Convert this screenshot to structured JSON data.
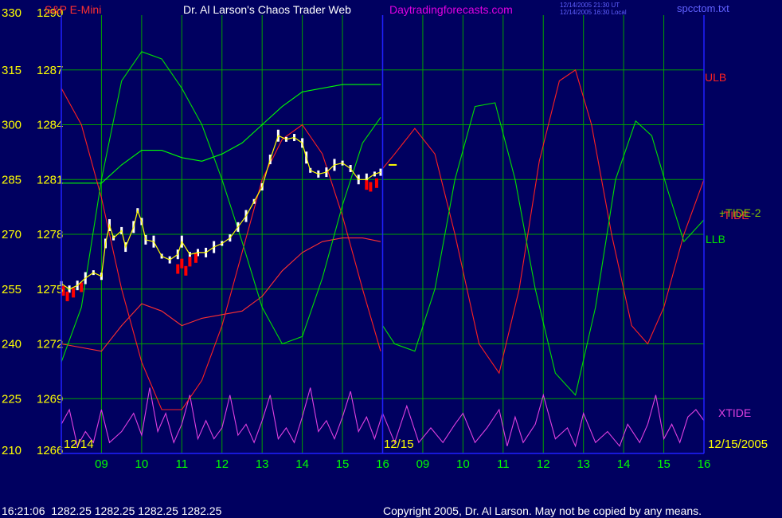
{
  "header": {
    "symbol": "S&P E-Mini",
    "site_title": "Dr. Al Larson's Chaos Trader Web",
    "site_url": "Daytradingforecasts.com",
    "stamp_line1": "12/14/2005 21:30 UT",
    "stamp_line2": "12/14/2005 16:30 Local",
    "file_name": "spcctom.txt"
  },
  "footer": {
    "quote": "16:21:06  1282.25 1282.25 1282.25 1282.25",
    "copyright": "Copyright 2005, Dr. Al Larson. May not be copied by any means."
  },
  "colors": {
    "background": "#000060",
    "grid": "#00a000",
    "left_axis_text": "#ffff00",
    "time_labels": "#00ff00",
    "price_bar": "#ffffff",
    "price_down": "#ff0000",
    "moving_avg_fast": "#ffff00",
    "moving_avg_slow": "#0000ff",
    "ulb": "#ff2020",
    "llb": "#00e000",
    "tide": "#ff3030",
    "tide2": "#00ff00",
    "xtide": "#e040e0",
    "divider": "#2020ff",
    "site_url": "#e000e0",
    "file_name": "#6060ff"
  },
  "chart_data": {
    "type": "line",
    "title": "S&P E-Mini",
    "oscillator_axis": {
      "ticks": [
        330,
        315,
        300,
        285,
        270,
        255,
        240,
        225,
        210
      ],
      "range": [
        210,
        330
      ]
    },
    "price_axis": {
      "ticks": [
        "1290",
        "1287",
        "1284",
        "1281",
        "1278",
        "1275",
        "1272",
        "1269",
        "1266"
      ],
      "range": [
        1266,
        1290
      ]
    },
    "date_labels": [
      "12/14",
      "12/15",
      "12/15/2005"
    ],
    "hour_labels": [
      "09",
      "10",
      "11",
      "12",
      "13",
      "14",
      "15",
      "16",
      "09",
      "10",
      "11",
      "12",
      "13",
      "14",
      "15",
      "16"
    ],
    "x_range": [
      0,
      16
    ],
    "series_labels": {
      "ulb": "ULB",
      "llb": "LLB",
      "tide": "-TIDE",
      "tide2": "+TIDE-2",
      "xtide": "XTIDE"
    },
    "last_price_marker": 1281.8,
    "price_close": [
      [
        0.0,
        1275.3
      ],
      [
        0.2,
        1275.0
      ],
      [
        0.4,
        1275.2
      ],
      [
        0.6,
        1275.6
      ],
      [
        0.8,
        1275.9
      ],
      [
        1.0,
        1275.7
      ],
      [
        1.1,
        1277.5
      ],
      [
        1.2,
        1278.5
      ],
      [
        1.3,
        1277.8
      ],
      [
        1.5,
        1278.2
      ],
      [
        1.6,
        1277.3
      ],
      [
        1.8,
        1278.4
      ],
      [
        1.9,
        1279.3
      ],
      [
        2.0,
        1278.7
      ],
      [
        2.1,
        1277.7
      ],
      [
        2.3,
        1277.6
      ],
      [
        2.5,
        1276.8
      ],
      [
        2.7,
        1276.6
      ],
      [
        2.9,
        1276.9
      ],
      [
        3.0,
        1277.6
      ],
      [
        3.2,
        1276.9
      ],
      [
        3.4,
        1277.0
      ],
      [
        3.6,
        1277.0
      ],
      [
        3.8,
        1277.3
      ],
      [
        4.0,
        1277.5
      ],
      [
        4.2,
        1277.8
      ],
      [
        4.4,
        1278.4
      ],
      [
        4.6,
        1279.0
      ],
      [
        4.8,
        1279.8
      ],
      [
        5.0,
        1280.6
      ],
      [
        5.2,
        1282.1
      ],
      [
        5.4,
        1283.4
      ],
      [
        5.6,
        1283.2
      ],
      [
        5.8,
        1283.3
      ],
      [
        6.0,
        1283.0
      ],
      [
        6.1,
        1282.2
      ],
      [
        6.2,
        1281.5
      ],
      [
        6.4,
        1281.3
      ],
      [
        6.6,
        1281.4
      ],
      [
        6.8,
        1281.8
      ],
      [
        7.0,
        1281.9
      ],
      [
        7.2,
        1281.6
      ],
      [
        7.4,
        1281.0
      ],
      [
        7.6,
        1281.0
      ],
      [
        7.8,
        1281.3
      ],
      [
        7.95,
        1281.4
      ]
    ],
    "sell_bars": [
      [
        0.05,
        1274.9
      ],
      [
        0.15,
        1274.6
      ],
      [
        0.3,
        1274.8
      ],
      [
        0.5,
        1275.1
      ],
      [
        2.9,
        1276.1
      ],
      [
        3.0,
        1276.4
      ],
      [
        3.1,
        1276.0
      ],
      [
        3.2,
        1276.5
      ],
      [
        3.35,
        1276.7
      ],
      [
        7.6,
        1280.7
      ],
      [
        7.7,
        1280.6
      ],
      [
        7.85,
        1280.8
      ]
    ],
    "ulb": [
      [
        0.0,
        310
      ],
      [
        0.5,
        300
      ],
      [
        1.0,
        280
      ],
      [
        1.5,
        255
      ],
      [
        2.0,
        235
      ],
      [
        2.5,
        222
      ],
      [
        3.0,
        222
      ],
      [
        3.5,
        230
      ],
      [
        4.0,
        245
      ],
      [
        4.5,
        265
      ],
      [
        5.0,
        285
      ],
      [
        5.5,
        296
      ],
      [
        6.0,
        300
      ],
      [
        6.5,
        292
      ],
      [
        7.0,
        275
      ],
      [
        7.5,
        255
      ],
      [
        7.95,
        238
      ],
      [
        8.0,
        288
      ],
      [
        8.3,
        292
      ],
      [
        8.8,
        299
      ],
      [
        9.3,
        292
      ],
      [
        9.8,
        270
      ],
      [
        10.4,
        240
      ],
      [
        10.9,
        232
      ],
      [
        11.4,
        255
      ],
      [
        11.9,
        290
      ],
      [
        12.4,
        312
      ],
      [
        12.8,
        315
      ],
      [
        13.2,
        300
      ],
      [
        13.7,
        270
      ],
      [
        14.2,
        245
      ],
      [
        14.6,
        240
      ],
      [
        15.0,
        250
      ],
      [
        15.5,
        270
      ],
      [
        16.0,
        285
      ]
    ],
    "llb": [
      [
        0.0,
        235
      ],
      [
        0.5,
        250
      ],
      [
        1.0,
        285
      ],
      [
        1.5,
        312
      ],
      [
        2.0,
        320
      ],
      [
        2.5,
        318
      ],
      [
        3.0,
        310
      ],
      [
        3.5,
        300
      ],
      [
        4.0,
        285
      ],
      [
        4.5,
        268
      ],
      [
        5.0,
        250
      ],
      [
        5.5,
        240
      ],
      [
        6.0,
        242
      ],
      [
        6.5,
        258
      ],
      [
        7.0,
        278
      ],
      [
        7.5,
        295
      ],
      [
        7.95,
        302
      ],
      [
        8.0,
        245
      ],
      [
        8.3,
        240
      ],
      [
        8.8,
        238
      ],
      [
        9.3,
        255
      ],
      [
        9.8,
        285
      ],
      [
        10.3,
        305
      ],
      [
        10.8,
        306
      ],
      [
        11.3,
        285
      ],
      [
        11.8,
        255
      ],
      [
        12.3,
        232
      ],
      [
        12.8,
        226
      ],
      [
        13.3,
        250
      ],
      [
        13.8,
        285
      ],
      [
        14.3,
        301
      ],
      [
        14.7,
        297
      ],
      [
        15.1,
        282
      ],
      [
        15.5,
        268
      ],
      [
        16.0,
        274
      ]
    ],
    "tide": [
      [
        0.0,
        240
      ],
      [
        1.0,
        238
      ],
      [
        1.5,
        245
      ],
      [
        2.0,
        251
      ],
      [
        2.5,
        249
      ],
      [
        3.0,
        245
      ],
      [
        3.5,
        247
      ],
      [
        4.0,
        248
      ],
      [
        4.5,
        249
      ],
      [
        5.0,
        253
      ],
      [
        5.5,
        260
      ],
      [
        6.0,
        265
      ],
      [
        6.5,
        268
      ],
      [
        7.0,
        269
      ],
      [
        7.5,
        269
      ],
      [
        7.95,
        268
      ]
    ],
    "tide2": [
      [
        0.0,
        284
      ],
      [
        1.0,
        284
      ],
      [
        1.5,
        289
      ],
      [
        2.0,
        293
      ],
      [
        2.5,
        293
      ],
      [
        3.0,
        291
      ],
      [
        3.5,
        290
      ],
      [
        4.0,
        292
      ],
      [
        4.5,
        295
      ],
      [
        5.0,
        300
      ],
      [
        5.5,
        305
      ],
      [
        6.0,
        309
      ],
      [
        7.0,
        311
      ],
      [
        7.95,
        311
      ]
    ],
    "xtide": [
      [
        0.0,
        218
      ],
      [
        0.2,
        222
      ],
      [
        0.4,
        212
      ],
      [
        0.6,
        216
      ],
      [
        0.8,
        213
      ],
      [
        1.0,
        222
      ],
      [
        1.2,
        213
      ],
      [
        1.5,
        216
      ],
      [
        1.8,
        221
      ],
      [
        2.0,
        215
      ],
      [
        2.2,
        228
      ],
      [
        2.4,
        216
      ],
      [
        2.6,
        221
      ],
      [
        2.8,
        213
      ],
      [
        3.0,
        218
      ],
      [
        3.2,
        226
      ],
      [
        3.4,
        214
      ],
      [
        3.6,
        219
      ],
      [
        3.8,
        214
      ],
      [
        4.0,
        217
      ],
      [
        4.2,
        226
      ],
      [
        4.4,
        215
      ],
      [
        4.6,
        218
      ],
      [
        4.8,
        213
      ],
      [
        5.0,
        219
      ],
      [
        5.2,
        226
      ],
      [
        5.4,
        214
      ],
      [
        5.6,
        217
      ],
      [
        5.8,
        213
      ],
      [
        6.0,
        220
      ],
      [
        6.2,
        228
      ],
      [
        6.4,
        216
      ],
      [
        6.6,
        219
      ],
      [
        6.8,
        214
      ],
      [
        7.0,
        220
      ],
      [
        7.2,
        227
      ],
      [
        7.4,
        216
      ],
      [
        7.6,
        220
      ],
      [
        7.8,
        214
      ],
      [
        8.0,
        221
      ],
      [
        8.3,
        213
      ],
      [
        8.6,
        223
      ],
      [
        8.9,
        213
      ],
      [
        9.2,
        217
      ],
      [
        9.5,
        213
      ],
      [
        9.8,
        218
      ],
      [
        10.0,
        221
      ],
      [
        10.3,
        213
      ],
      [
        10.6,
        217
      ],
      [
        10.9,
        222
      ],
      [
        11.1,
        212
      ],
      [
        11.3,
        220
      ],
      [
        11.5,
        213
      ],
      [
        11.8,
        218
      ],
      [
        12.0,
        226
      ],
      [
        12.3,
        214
      ],
      [
        12.6,
        217
      ],
      [
        12.8,
        212
      ],
      [
        13.0,
        221
      ],
      [
        13.3,
        213
      ],
      [
        13.6,
        216
      ],
      [
        13.9,
        212
      ],
      [
        14.1,
        218
      ],
      [
        14.4,
        213
      ],
      [
        14.6,
        218
      ],
      [
        14.8,
        226
      ],
      [
        15.0,
        214
      ],
      [
        15.2,
        218
      ],
      [
        15.4,
        213
      ],
      [
        15.6,
        220
      ],
      [
        15.8,
        222
      ],
      [
        16.0,
        219
      ]
    ]
  }
}
